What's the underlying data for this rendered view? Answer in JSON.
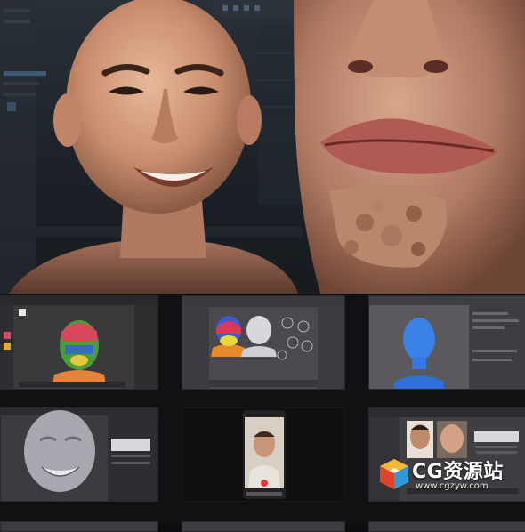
{
  "hero": {
    "left_face": "smiling-bald-head-render",
    "right_face": "closeup-lips-chin-render"
  },
  "thumbnails": [
    {
      "name": "zbrush-polypaint-head",
      "bg": "#3a3a3c"
    },
    {
      "name": "maya-colored-heads-blendshapes",
      "bg": "#4a4a4e"
    },
    {
      "name": "blue-head-bust-viewport",
      "bg": "#505055"
    },
    {
      "name": "grey-smile-sculpt",
      "bg": "#3c3c40"
    },
    {
      "name": "phone-face-capture",
      "bg": "#0f0f10"
    },
    {
      "name": "face-reference-comparison",
      "bg": "#3f3f43"
    }
  ],
  "watermark": {
    "title": "CG资源站",
    "url": "www.cgzyw.com",
    "colors": {
      "top": "#f5b73b",
      "left": "#e0452c",
      "right": "#2f9ad6",
      "front": "#5cb85c"
    }
  }
}
